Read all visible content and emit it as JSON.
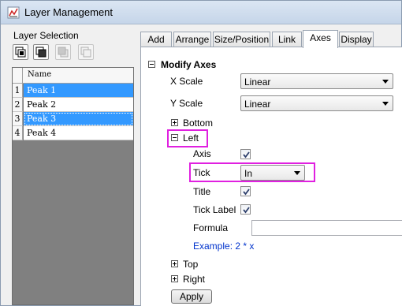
{
  "window": {
    "title": "Layer Management"
  },
  "layer_selection": {
    "heading": "Layer Selection",
    "column_header": "Name",
    "rows": [
      {
        "num": "1",
        "name": "Peak 1",
        "selected": true
      },
      {
        "num": "2",
        "name": "Peak 2",
        "selected": false
      },
      {
        "num": "3",
        "name": "Peak 3",
        "selected": true
      },
      {
        "num": "4",
        "name": "Peak 4",
        "selected": false
      }
    ]
  },
  "tabs": [
    "Add",
    "Arrange",
    "Size/Position",
    "Link",
    "Axes",
    "Display"
  ],
  "active_tab": "Axes",
  "axes": {
    "section_title": "Modify Axes",
    "x_scale_label": "X Scale",
    "x_scale_value": "Linear",
    "y_scale_label": "Y Scale",
    "y_scale_value": "Linear",
    "bottom_label": "Bottom",
    "left_label": "Left",
    "axis_label": "Axis",
    "axis_checked": true,
    "tick_label": "Tick",
    "tick_value": "In",
    "title_label": "Title",
    "title_checked": true,
    "tick_label_label": "Tick Label",
    "tick_label_checked": true,
    "formula_label": "Formula",
    "formula_value": "",
    "example_text": "Example: 2 * x",
    "top_label": "Top",
    "right_label": "Right",
    "apply_label": "Apply"
  },
  "colors": {
    "highlight": "#e020e0",
    "selection": "#3399ff",
    "hint_text": "#0033cc"
  }
}
